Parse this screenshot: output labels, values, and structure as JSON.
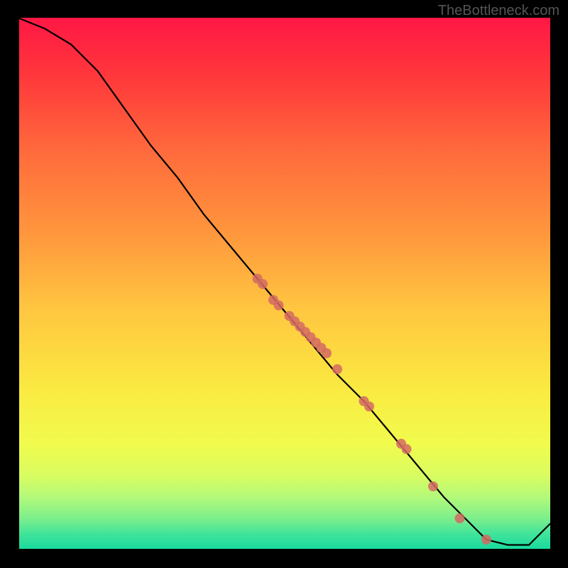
{
  "watermark": "TheBottleneck.com",
  "chart_data": {
    "type": "line",
    "title": "",
    "xlabel": "",
    "ylabel": "",
    "xlim": [
      0,
      100
    ],
    "ylim": [
      0,
      100
    ],
    "series": [
      {
        "name": "curve",
        "x": [
          0,
          5,
          10,
          15,
          20,
          25,
          30,
          35,
          40,
          45,
          50,
          55,
          60,
          65,
          70,
          75,
          80,
          85,
          88,
          92,
          96,
          100
        ],
        "y": [
          100,
          98,
          95,
          90,
          83,
          76,
          70,
          63,
          57,
          51,
          45,
          39,
          33,
          28,
          22,
          16,
          10,
          5,
          2,
          1,
          1,
          5
        ]
      }
    ],
    "points": {
      "name": "markers",
      "color": "#d46a63",
      "x": [
        45,
        46,
        48,
        49,
        51,
        52,
        53,
        54,
        55,
        56,
        57,
        58,
        60,
        65,
        66,
        72,
        73,
        78,
        83,
        88
      ],
      "y": [
        51,
        50,
        47,
        46,
        44,
        43,
        42,
        41,
        40,
        39,
        38,
        37,
        34,
        28,
        27,
        20,
        19,
        12,
        6,
        2
      ]
    },
    "background_gradient": {
      "stops": [
        {
          "offset": 0.0,
          "color": "#ff1744"
        },
        {
          "offset": 0.12,
          "color": "#ff3b3b"
        },
        {
          "offset": 0.25,
          "color": "#ff6a3c"
        },
        {
          "offset": 0.4,
          "color": "#ff953d"
        },
        {
          "offset": 0.55,
          "color": "#ffc740"
        },
        {
          "offset": 0.7,
          "color": "#faea41"
        },
        {
          "offset": 0.8,
          "color": "#f1fb4d"
        },
        {
          "offset": 0.86,
          "color": "#d9fc60"
        },
        {
          "offset": 0.9,
          "color": "#b3f97a"
        },
        {
          "offset": 0.94,
          "color": "#7def8c"
        },
        {
          "offset": 0.97,
          "color": "#3fe39a"
        },
        {
          "offset": 1.0,
          "color": "#17d99e"
        }
      ]
    }
  }
}
